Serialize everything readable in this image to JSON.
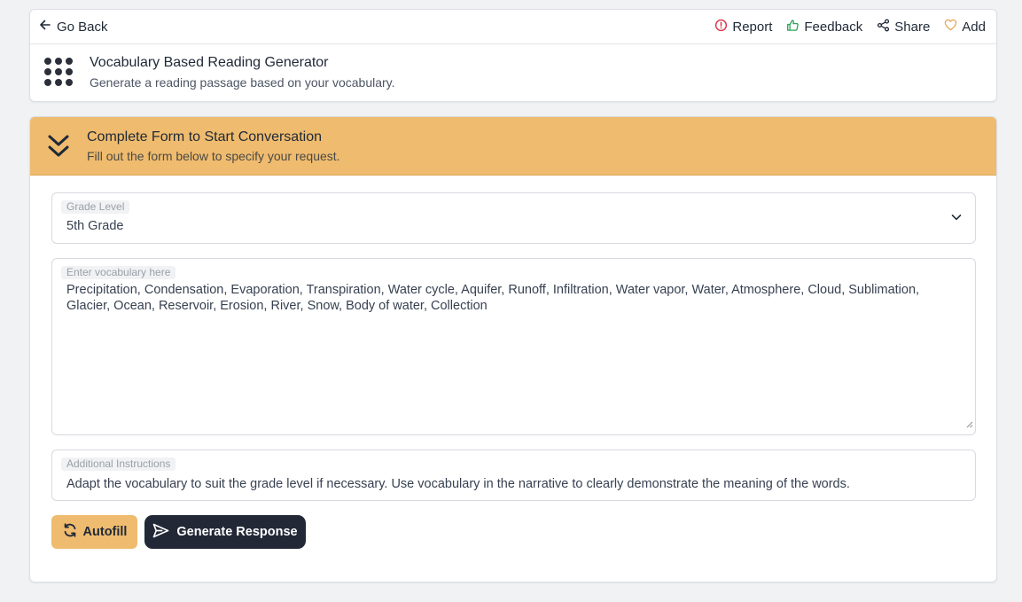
{
  "header": {
    "go_back_label": "Go Back",
    "actions": {
      "report": "Report",
      "feedback": "Feedback",
      "share": "Share",
      "add": "Add"
    }
  },
  "tool": {
    "title": "Vocabulary Based Reading Generator",
    "subtitle": "Generate a reading passage based on your vocabulary."
  },
  "form": {
    "title": "Complete Form to Start Conversation",
    "subtitle": "Fill out the form below to specify your request.",
    "grade_level": {
      "label": "Grade Level",
      "value": "5th Grade"
    },
    "vocabulary": {
      "placeholder": "Enter vocabulary here",
      "value": "Precipitation, Condensation, Evaporation, Transpiration, Water cycle, Aquifer, Runoff, Infiltration, Water vapor, Water, Atmosphere, Cloud, Sublimation, Glacier, Ocean, Reservoir, Erosion, River, Snow, Body of water, Collection"
    },
    "instructions": {
      "label": "Additional Instructions",
      "value": "Adapt the vocabulary to suit the grade level if necessary. Use vocabulary in the narrative to clearly demonstrate the meaning of the words."
    },
    "buttons": {
      "autofill": "Autofill",
      "generate": "Generate Response"
    }
  },
  "colors": {
    "accent": "#efbb6e",
    "dark_button": "#222836",
    "report_icon": "#d6334a",
    "feedback_icon": "#2fa35a",
    "add_icon": "#e9a55a"
  }
}
